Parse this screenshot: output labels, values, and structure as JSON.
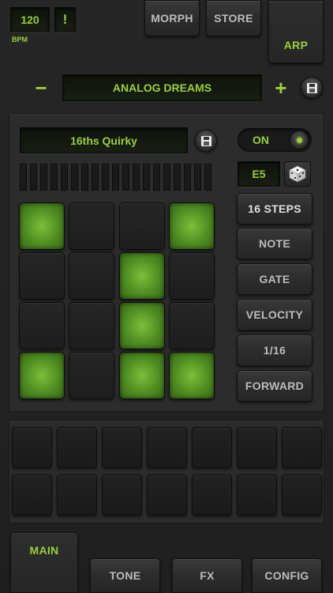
{
  "header": {
    "bpm_value": "120",
    "bpm_label": "BPM",
    "alert_label": "!",
    "morph_label": "MORPH",
    "store_label": "STORE",
    "arp_label": "ARP"
  },
  "preset": {
    "minus_label": "−",
    "name": "ANALOG DREAMS",
    "plus_label": "+"
  },
  "arp": {
    "pattern_name": "16ths Quirky",
    "on_label": "ON",
    "note_value": "E5",
    "buttons": [
      "16 STEPS",
      "NOTE",
      "GATE",
      "VELOCITY",
      "1/16",
      "FORWARD"
    ],
    "pads": [
      [
        true,
        false,
        false,
        true
      ],
      [
        false,
        false,
        true,
        false
      ],
      [
        false,
        false,
        true,
        false
      ],
      [
        true,
        false,
        true,
        true
      ]
    ]
  },
  "tabs": [
    "MAIN",
    "TONE",
    "FX",
    "CONFIG"
  ],
  "colors": {
    "accent": "#9ad03a",
    "pad_on": "#5a9a28",
    "background": "#232323"
  }
}
